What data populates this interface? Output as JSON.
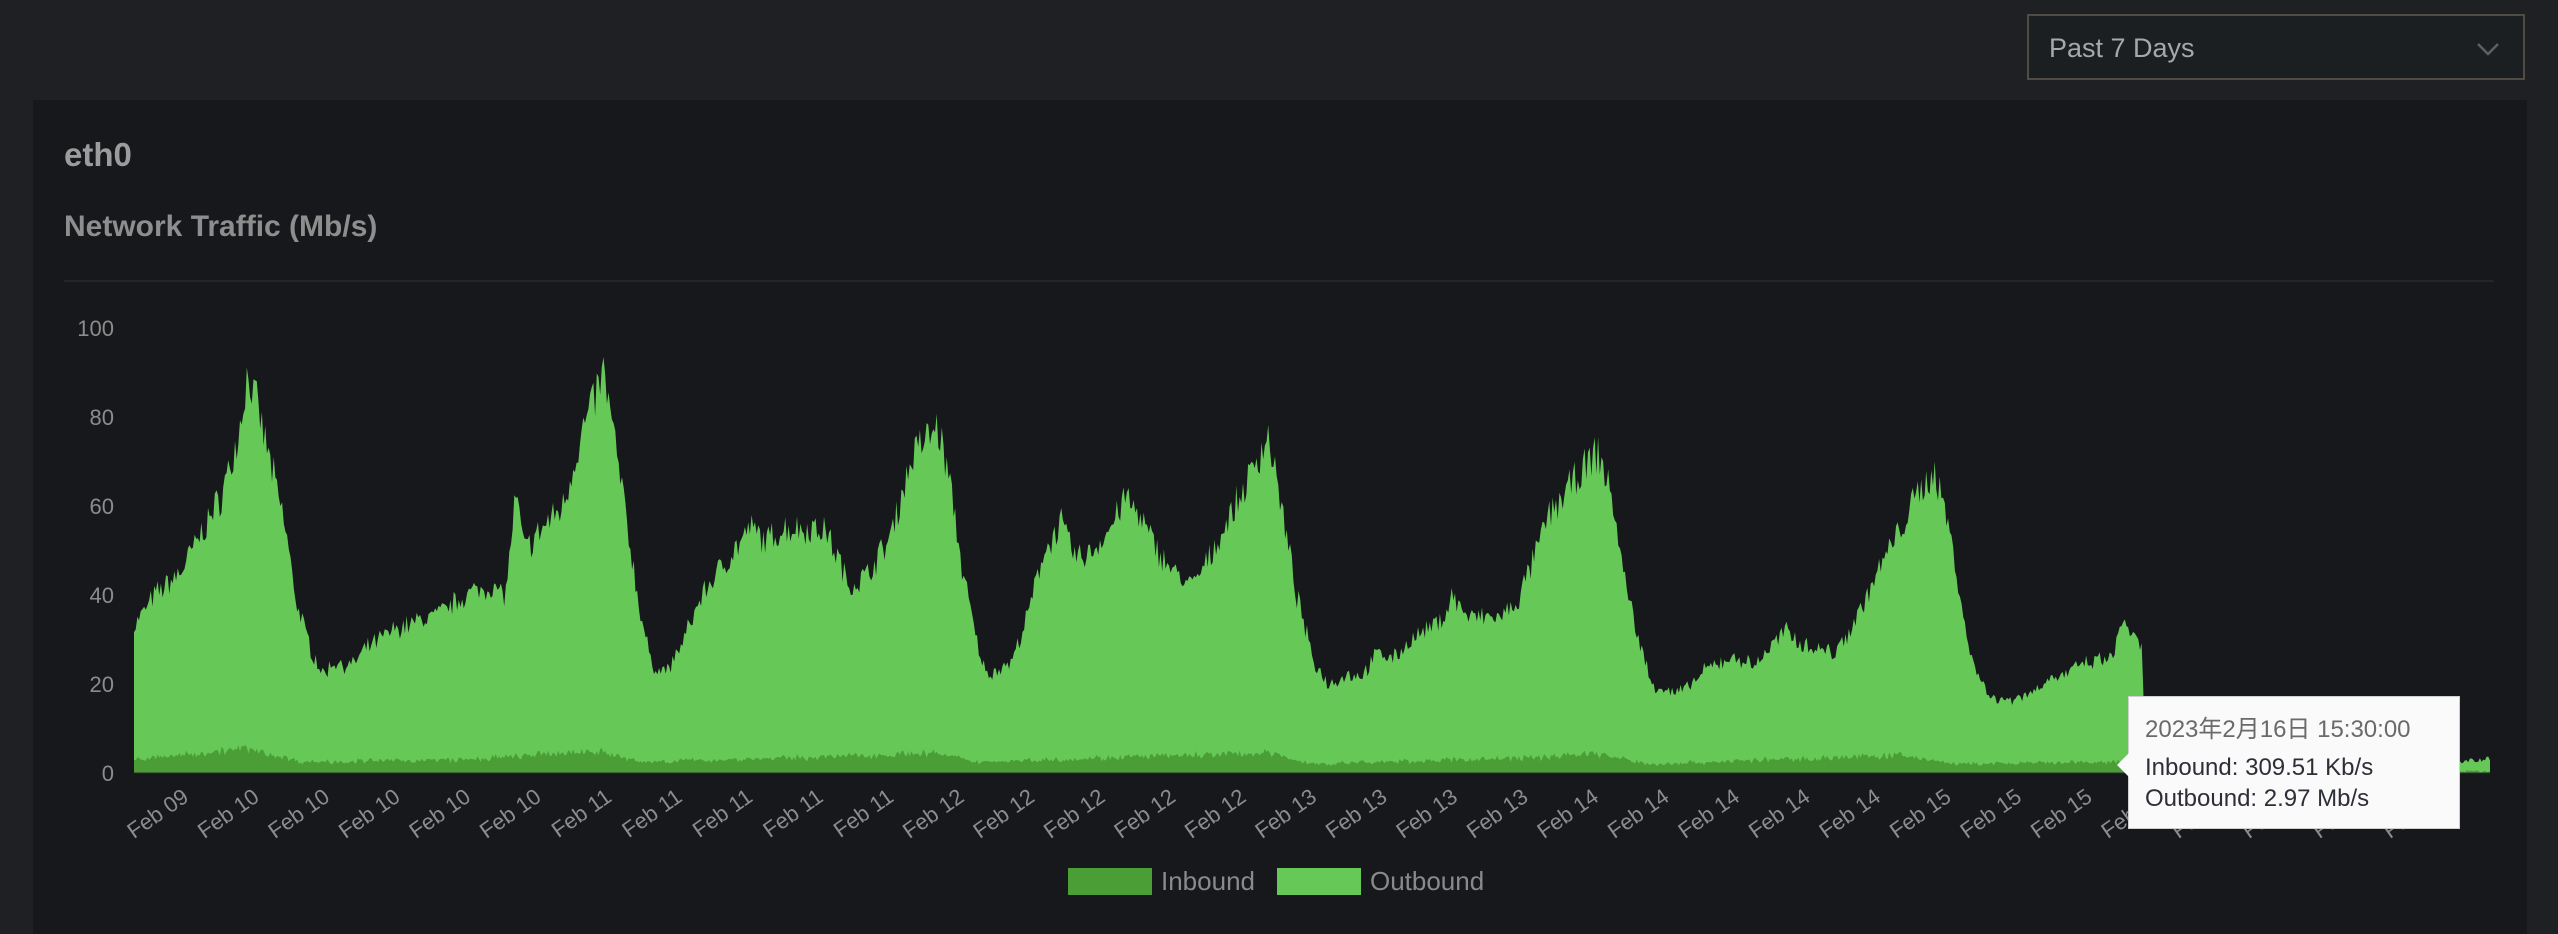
{
  "range_select": {
    "selected": "Past 7 Days",
    "icon": "chevron-down-icon"
  },
  "card": {
    "title": "eth0",
    "subtitle": "Network Traffic (Mb/s)"
  },
  "tooltip": {
    "time": "2023年2月16日 15:30:00",
    "inbound": "Inbound: 309.51 Kb/s",
    "outbound": "Outbound: 2.97 Mb/s"
  },
  "colors": {
    "inbound": "#4a9e35",
    "outbound": "#66c957",
    "background": "#16181b"
  },
  "chart_data": {
    "type": "area",
    "title": "Network Traffic (Mb/s)",
    "xlabel": "",
    "ylabel": "Mb/s",
    "ylim": [
      0,
      100
    ],
    "xlim_hours": [
      0,
      168
    ],
    "yticks": [
      "0",
      "20",
      "40",
      "60",
      "80",
      "100"
    ],
    "xticks": [
      "Feb 09",
      "Feb 10",
      "Feb 10",
      "Feb 10",
      "Feb 10",
      "Feb 10",
      "Feb 11",
      "Feb 11",
      "Feb 11",
      "Feb 11",
      "Feb 11",
      "Feb 12",
      "Feb 12",
      "Feb 12",
      "Feb 12",
      "Feb 12",
      "Feb 13",
      "Feb 13",
      "Feb 13",
      "Feb 13",
      "Feb 14",
      "Feb 14",
      "Feb 14",
      "Feb 14",
      "Feb 14",
      "Feb 15",
      "Feb 15",
      "Feb 15",
      "Feb 15",
      "Feb 16",
      "Feb 16",
      "Feb 16",
      "Feb 16"
    ],
    "legend": {
      "position": "bottom",
      "items": [
        "Inbound",
        "Outbound"
      ]
    },
    "series": [
      {
        "name": "Outbound",
        "x_hours": [
          0,
          1.5,
          3.3,
          5,
          6.2,
          7.4,
          8.1,
          8.8,
          9.7,
          10.8,
          11.6,
          12.6,
          13.5,
          14.3,
          15.5,
          16.6,
          18.4,
          20.1,
          21.9,
          23.6,
          25.4,
          26.5,
          27.2,
          27.9,
          29.4,
          30.6,
          31.8,
          32.6,
          33.5,
          34.4,
          35.2,
          36,
          36.9,
          38.1,
          39.2,
          40.5,
          41.6,
          42.8,
          44,
          45.1,
          46.3,
          48,
          49.2,
          50.4,
          50.9,
          52.1,
          53.8,
          54.7,
          55.6,
          56.5,
          57.3,
          58.2,
          59.1,
          60.2,
          60.8,
          62.6,
          63.7,
          64.9,
          66.1,
          67.2,
          68.4,
          69.6,
          70.7,
          71.6,
          73,
          74.2,
          75.4,
          76.5,
          77.7,
          78.9,
          80,
          80.9,
          81.8,
          82.9,
          84.1,
          85.2,
          86.4,
          87.6,
          88.7,
          89.9,
          91.1,
          92.2,
          93.4,
          94,
          95.1,
          96.3,
          97.5,
          98.6,
          99.8,
          100.9,
          102.1,
          103.3,
          104.4,
          105.4,
          106.2,
          107.3,
          108.2,
          109.7,
          110.8,
          112,
          113.2,
          114.3,
          115.5,
          116.6,
          117.8,
          119,
          120.1,
          121.3,
          122.5,
          123.6,
          124.8,
          126,
          127.1,
          128.3,
          129.1,
          130,
          130.8,
          131.8,
          132.9,
          134.1,
          135.3,
          136.4,
          137.6,
          138.7,
          139.9,
          141.1,
          141.9,
          142.6,
          143.2,
          143.4,
          168
        ],
        "values": [
          33,
          40,
          45,
          55,
          62,
          75,
          90,
          82,
          70,
          55,
          38,
          28,
          22,
          25,
          24,
          28,
          32,
          34,
          36,
          40,
          42,
          40,
          62,
          50,
          56,
          60,
          75,
          82,
          90,
          72,
          55,
          38,
          24,
          23,
          30,
          40,
          45,
          50,
          55,
          52,
          55,
          55,
          55,
          47,
          42,
          44,
          52,
          62,
          72,
          75,
          78,
          65,
          45,
          28,
          22,
          25,
          35,
          50,
          56,
          48,
          50,
          55,
          62,
          58,
          50,
          45,
          42,
          47,
          55,
          62,
          70,
          76,
          60,
          40,
          25,
          20,
          22,
          22,
          27,
          26,
          30,
          32,
          35,
          40,
          35,
          35,
          35,
          38,
          48,
          58,
          63,
          68,
          72,
          62,
          45,
          30,
          20,
          18,
          19,
          23,
          25,
          26,
          24,
          28,
          32,
          29,
          28,
          27,
          33,
          40,
          48,
          55,
          62,
          68,
          60,
          45,
          28,
          20,
          16,
          17,
          18,
          21,
          22,
          24,
          25,
          26,
          35,
          30,
          28,
          3,
          3
        ]
      },
      {
        "name": "Inbound",
        "x_hours": [
          0,
          8,
          12,
          24,
          33,
          36,
          48,
          57,
          60,
          70,
          81,
          84,
          100,
          104,
          108,
          126,
          130,
          143,
          143.4,
          168
        ],
        "values": [
          3,
          5.5,
          2.5,
          3,
          5,
          2.5,
          3.5,
          4.5,
          2.5,
          3.5,
          4.5,
          2,
          3.5,
          4.5,
          2,
          4,
          2,
          2.5,
          0.3,
          0.3
        ]
      }
    ]
  }
}
